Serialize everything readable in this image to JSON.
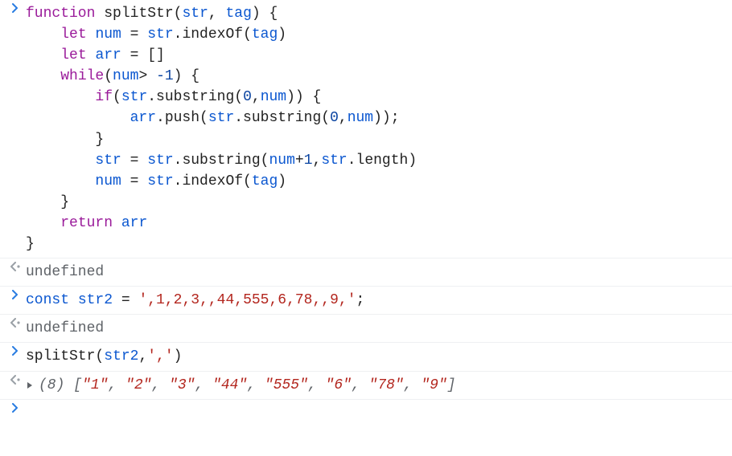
{
  "console": {
    "entries": [
      {
        "kind": "input",
        "code": [
          {
            "indent": 0,
            "tokens": [
              {
                "t": "function",
                "c": "kw"
              },
              {
                "t": " "
              },
              {
                "t": "splitStr",
                "c": "fn"
              },
              {
                "t": "(",
                "c": "op"
              },
              {
                "t": "str",
                "c": "id"
              },
              {
                "t": ", "
              },
              {
                "t": "tag",
                "c": "id"
              },
              {
                "t": ") {",
                "c": "op"
              }
            ]
          },
          {
            "indent": 1,
            "tokens": [
              {
                "t": "let",
                "c": "kw"
              },
              {
                "t": " "
              },
              {
                "t": "num",
                "c": "id"
              },
              {
                "t": " = "
              },
              {
                "t": "str",
                "c": "id"
              },
              {
                "t": ".indexOf(",
                "c": "op"
              },
              {
                "t": "tag",
                "c": "id"
              },
              {
                "t": ")",
                "c": "op"
              }
            ]
          },
          {
            "indent": 1,
            "tokens": [
              {
                "t": "let",
                "c": "kw"
              },
              {
                "t": " "
              },
              {
                "t": "arr",
                "c": "id"
              },
              {
                "t": " = []",
                "c": "op"
              }
            ]
          },
          {
            "indent": 1,
            "tokens": [
              {
                "t": "while",
                "c": "kw"
              },
              {
                "t": "(",
                "c": "op"
              },
              {
                "t": "num",
                "c": "id"
              },
              {
                "t": "> ",
                "c": "op"
              },
              {
                "t": "-1",
                "c": "num"
              },
              {
                "t": ") {",
                "c": "op"
              }
            ]
          },
          {
            "indent": 2,
            "tokens": [
              {
                "t": "if",
                "c": "kw"
              },
              {
                "t": "(",
                "c": "op"
              },
              {
                "t": "str",
                "c": "id"
              },
              {
                "t": ".substring(",
                "c": "op"
              },
              {
                "t": "0",
                "c": "num"
              },
              {
                "t": ",",
                "c": "op"
              },
              {
                "t": "num",
                "c": "id"
              },
              {
                "t": ")) {",
                "c": "op"
              }
            ]
          },
          {
            "indent": 3,
            "tokens": [
              {
                "t": "arr",
                "c": "id"
              },
              {
                "t": ".push(",
                "c": "op"
              },
              {
                "t": "str",
                "c": "id"
              },
              {
                "t": ".substring(",
                "c": "op"
              },
              {
                "t": "0",
                "c": "num"
              },
              {
                "t": ",",
                "c": "op"
              },
              {
                "t": "num",
                "c": "id"
              },
              {
                "t": "));",
                "c": "op"
              }
            ]
          },
          {
            "indent": 2,
            "tokens": [
              {
                "t": "}",
                "c": "op"
              }
            ]
          },
          {
            "indent": 2,
            "tokens": [
              {
                "t": "str",
                "c": "id"
              },
              {
                "t": " = "
              },
              {
                "t": "str",
                "c": "id"
              },
              {
                "t": ".substring(",
                "c": "op"
              },
              {
                "t": "num",
                "c": "id"
              },
              {
                "t": "+",
                "c": "op"
              },
              {
                "t": "1",
                "c": "num"
              },
              {
                "t": ",",
                "c": "op"
              },
              {
                "t": "str",
                "c": "id"
              },
              {
                "t": ".length)",
                "c": "op"
              }
            ]
          },
          {
            "indent": 2,
            "tokens": [
              {
                "t": "num",
                "c": "id"
              },
              {
                "t": " = "
              },
              {
                "t": "str",
                "c": "id"
              },
              {
                "t": ".indexOf(",
                "c": "op"
              },
              {
                "t": "tag",
                "c": "id"
              },
              {
                "t": ")",
                "c": "op"
              }
            ]
          },
          {
            "indent": 1,
            "tokens": [
              {
                "t": "}",
                "c": "op"
              }
            ]
          },
          {
            "indent": 1,
            "tokens": [
              {
                "t": "return",
                "c": "kw"
              },
              {
                "t": " "
              },
              {
                "t": "arr",
                "c": "id"
              }
            ]
          },
          {
            "indent": 0,
            "tokens": [
              {
                "t": "}",
                "c": "op"
              }
            ]
          }
        ]
      },
      {
        "kind": "output",
        "result": {
          "type": "undefined",
          "text": "undefined"
        }
      },
      {
        "kind": "input",
        "code": [
          {
            "indent": 0,
            "tokens": [
              {
                "t": "const",
                "c": "kw2"
              },
              {
                "t": " "
              },
              {
                "t": "str2",
                "c": "id"
              },
              {
                "t": " = "
              },
              {
                "t": "',1,2,3,,44,555,6,78,,9,'",
                "c": "str"
              },
              {
                "t": ";",
                "c": "op"
              }
            ]
          }
        ]
      },
      {
        "kind": "output",
        "result": {
          "type": "undefined",
          "text": "undefined"
        }
      },
      {
        "kind": "input",
        "code": [
          {
            "indent": 0,
            "tokens": [
              {
                "t": "splitStr(",
                "c": "plain"
              },
              {
                "t": "str2",
                "c": "id"
              },
              {
                "t": ",",
                "c": "op"
              },
              {
                "t": "','",
                "c": "str"
              },
              {
                "t": ")",
                "c": "op"
              }
            ]
          }
        ]
      },
      {
        "kind": "output",
        "result": {
          "type": "array",
          "length": 8,
          "items": [
            "\"1\"",
            "\"2\"",
            "\"3\"",
            "\"44\"",
            "\"555\"",
            "\"6\"",
            "\"78\"",
            "\"9\""
          ]
        }
      }
    ],
    "prompt_icon": "›"
  },
  "colors": {
    "keyword": "#9a1b9a",
    "identifier": "#0b57d0",
    "number": "#0842a0",
    "string": "#b3261e",
    "muted": "#5f6368",
    "border": "#eef0f2"
  },
  "glyphs": {
    "input_prompt": "›",
    "output_prompt": "‹·",
    "expand_triangle": "▶"
  }
}
